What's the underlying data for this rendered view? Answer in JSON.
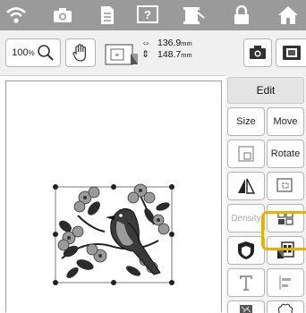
{
  "top_bar": {
    "icons": [
      "wifi-icon",
      "camera-icon",
      "document-icon",
      "help-icon",
      "thread-icon",
      "lock-icon",
      "home-icon"
    ]
  },
  "toolbar": {
    "zoom_level": "100",
    "zoom_unit": "%",
    "width_value": "136.9",
    "height_value": "148.7",
    "unit": "mm"
  },
  "edit_panel": {
    "tab_label": "Edit",
    "buttons": [
      {
        "label": "Size",
        "enabled": true
      },
      {
        "label": "Move",
        "enabled": true
      },
      {
        "label": "",
        "icon": "frame-outline-icon"
      },
      {
        "label": "Rotate",
        "enabled": true
      },
      {
        "label": "",
        "icon": "mirror-icon"
      },
      {
        "label": "",
        "icon": "border-icon"
      },
      {
        "label": "Density",
        "enabled": false
      },
      {
        "label": "",
        "icon": "array-icon"
      },
      {
        "label": "",
        "icon": "applique-icon"
      },
      {
        "label": "",
        "icon": "thread-color-icon",
        "highlighted": true
      },
      {
        "label": "",
        "icon": "text-icon"
      },
      {
        "label": "",
        "icon": "align-icon"
      },
      {
        "label": "",
        "icon": "stippling-icon"
      },
      {
        "label": "",
        "icon": "outline-shape-icon"
      }
    ]
  },
  "colors": {
    "top_bar": "#9a9a9a",
    "highlight": "#e7b100"
  }
}
